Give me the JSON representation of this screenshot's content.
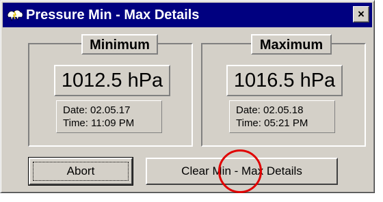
{
  "window": {
    "title": "Pressure Min - Max Details",
    "close_label": "×",
    "icon": "weather-station-icon"
  },
  "minimum": {
    "label": "Minimum",
    "value": "1012.5 hPa",
    "date": "Date: 02.05.17",
    "time": "Time: 11:09 PM"
  },
  "maximum": {
    "label": "Maximum",
    "value": "1016.5 hPa",
    "date": "Date: 02.05.18",
    "time": "Time: 05:21 PM"
  },
  "buttons": {
    "abort": "Abort",
    "clear": "Clear Min - Max Details"
  },
  "colors": {
    "titlebar": "#000080",
    "face": "#d4d0c8",
    "highlight_circle": "#e00000"
  }
}
